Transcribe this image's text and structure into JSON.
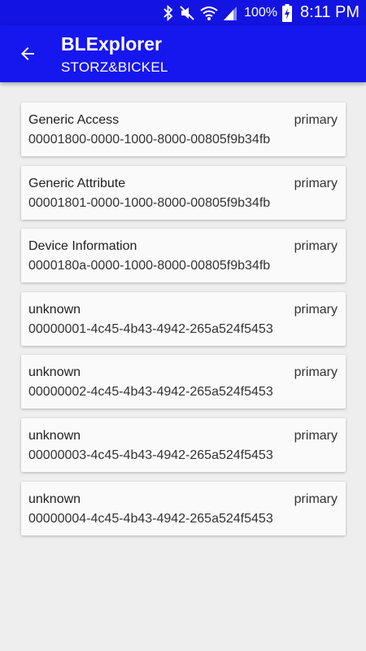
{
  "status_bar": {
    "battery_percent": "100%",
    "time": "8:11 PM",
    "icons": [
      "bluetooth-icon",
      "mute-icon",
      "wifi-icon",
      "signal-icon",
      "battery-charging-icon"
    ]
  },
  "app_bar": {
    "back_icon": "arrow-back-icon",
    "title": "BLExplorer",
    "subtitle": "STORZ&BICKEL",
    "color": "#1616ef"
  },
  "services": [
    {
      "name": "Generic Access",
      "type": "primary",
      "uuid": "00001800-0000-1000-8000-00805f9b34fb"
    },
    {
      "name": "Generic Attribute",
      "type": "primary",
      "uuid": "00001801-0000-1000-8000-00805f9b34fb"
    },
    {
      "name": "Device Information",
      "type": "primary",
      "uuid": "0000180a-0000-1000-8000-00805f9b34fb"
    },
    {
      "name": "unknown",
      "type": "primary",
      "uuid": "00000001-4c45-4b43-4942-265a524f5453"
    },
    {
      "name": "unknown",
      "type": "primary",
      "uuid": "00000002-4c45-4b43-4942-265a524f5453"
    },
    {
      "name": "unknown",
      "type": "primary",
      "uuid": "00000003-4c45-4b43-4942-265a524f5453"
    },
    {
      "name": "unknown",
      "type": "primary",
      "uuid": "00000004-4c45-4b43-4942-265a524f5453"
    }
  ]
}
